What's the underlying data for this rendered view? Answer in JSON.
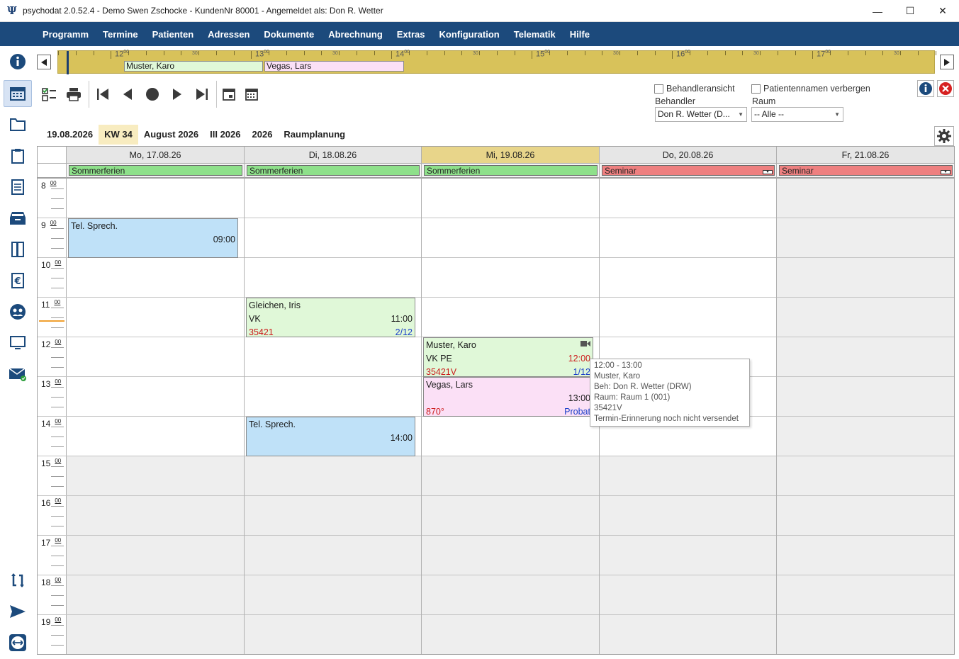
{
  "window": {
    "title": "psychodat 2.0.52.4 - Demo Swen Zschocke - KundenNr 80001 - Angemeldet als: Don R. Wetter",
    "app_icon": "Ψ",
    "minimize": "—",
    "maximize": "☐",
    "close": "✕"
  },
  "menu": [
    "Programm",
    "Termine",
    "Patienten",
    "Adressen",
    "Dokumente",
    "Abrechnung",
    "Extras",
    "Konfiguration",
    "Telematik",
    "Hilfe"
  ],
  "timeline": {
    "hours": [
      "12",
      "13",
      "14",
      "15",
      "16",
      "17"
    ],
    "hour_sup": "00",
    "half_label": "30",
    "blocks": [
      {
        "label": "Muster, Karo",
        "color": "#e0f8d8"
      },
      {
        "label": "Vegas, Lars",
        "color": "#fbe0f6"
      }
    ]
  },
  "filters": {
    "behandleransicht": "Behandleransicht",
    "patientennamen_verbergen": "Patientennamen verbergen",
    "behandler_label": "Behandler",
    "behandler_value": "Don R. Wetter (D...",
    "raum_label": "Raum",
    "raum_value": "-- Alle --"
  },
  "view_tabs": [
    {
      "label": "19.08.2026",
      "selected": false
    },
    {
      "label": "KW 34",
      "selected": true
    },
    {
      "label": "August 2026",
      "selected": false
    },
    {
      "label": "III 2026",
      "selected": false
    },
    {
      "label": "2026",
      "selected": false
    },
    {
      "label": "Raumplanung",
      "selected": false
    }
  ],
  "calendar": {
    "hour_sup": "00",
    "hours": [
      "8",
      "9",
      "10",
      "11",
      "12",
      "13",
      "14",
      "15",
      "16",
      "17",
      "18",
      "19"
    ],
    "days": [
      {
        "label": "Mo, 17.08.26",
        "today": false,
        "allday": {
          "label": "Sommerferien",
          "color": "#8ee08a"
        }
      },
      {
        "label": "Di, 18.08.26",
        "today": false,
        "allday": {
          "label": "Sommerferien",
          "color": "#8ee08a"
        }
      },
      {
        "label": "Mi, 19.08.26",
        "today": true,
        "allday": {
          "label": "Sommerferien",
          "color": "#8ee08a"
        }
      },
      {
        "label": "Do, 20.08.26",
        "today": false,
        "allday": {
          "label": "Seminar",
          "color": "#ee8080"
        }
      },
      {
        "label": "Fr, 21.08.26",
        "today": false,
        "allday": {
          "label": "Seminar",
          "color": "#ee8080"
        }
      }
    ],
    "appointments": [
      {
        "day": 0,
        "name": "Tel. Sprech.",
        "type": "",
        "time": "09:00",
        "code": "",
        "extra": "",
        "color": "#bfe1f8"
      },
      {
        "day": 1,
        "name": "Gleichen, Iris",
        "type": "VK",
        "time": "11:00",
        "code": "35421",
        "extra": "2/12",
        "color": "#e0f8d8"
      },
      {
        "day": 1,
        "name": "Tel. Sprech.",
        "type": "",
        "time": "14:00",
        "code": "",
        "extra": "",
        "color": "#bfe1f8"
      },
      {
        "day": 2,
        "name": "Muster, Karo",
        "type": "VK PE",
        "time": "12:00",
        "code": "35421V",
        "extra": "1/12",
        "color": "#e0f8d8"
      },
      {
        "day": 2,
        "name": "Vegas, Lars",
        "type": "",
        "time": "13:00",
        "code": "870°",
        "extra": "Probat",
        "color": "#fbe0f6"
      }
    ]
  },
  "tooltip": {
    "lines": [
      "12:00 - 13:00",
      "Muster, Karo",
      "Beh: Don R. Wetter (DRW)",
      "Raum: Raum 1 (001)",
      "35421V",
      "Termin-Erinnerung noch nicht versendet"
    ]
  }
}
